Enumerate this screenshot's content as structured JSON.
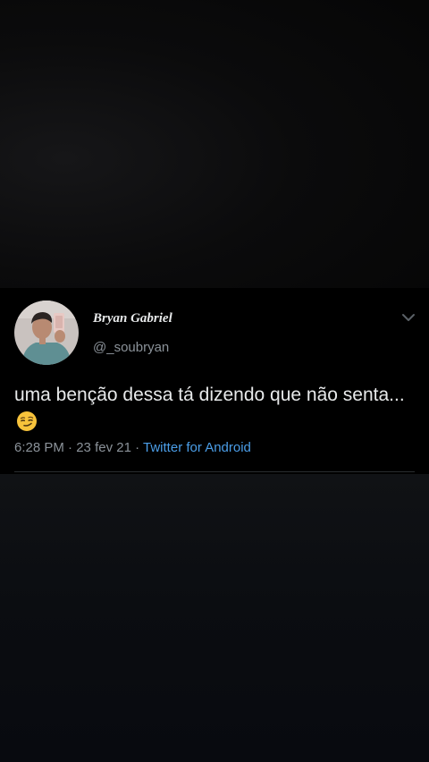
{
  "tweet": {
    "display_name": "Bryan Gabriel",
    "handle": "@_soubryan",
    "text": "uma benção dessa tá dizendo que não senta...",
    "emoji": "smirking-face",
    "time": "6:28 PM",
    "separator": "·",
    "date": "23 fev 21",
    "source": "Twitter for Android"
  },
  "icons": {
    "menu": "chevron-down-icon"
  },
  "colors": {
    "background": "#000000",
    "text_primary": "#e7e9ea",
    "text_secondary": "#8b9299",
    "link": "#4b9ee8"
  }
}
